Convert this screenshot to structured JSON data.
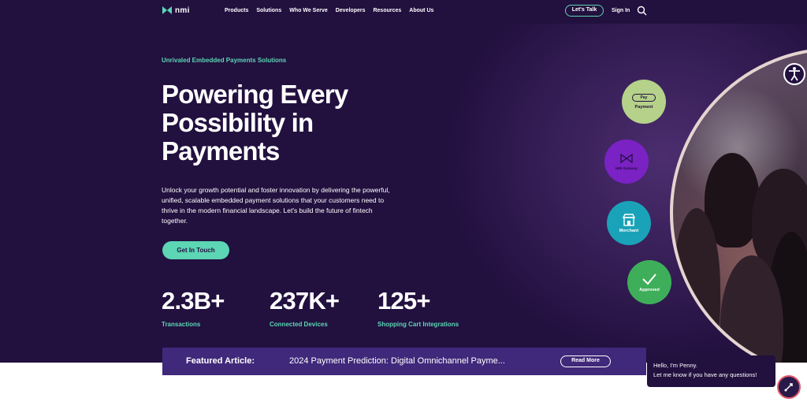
{
  "nav": {
    "logo_text": "nmi",
    "links": [
      "Products",
      "Solutions",
      "Who We Serve",
      "Developers",
      "Resources",
      "About Us"
    ],
    "talk_label": "Let's Talk",
    "signin_label": "Sign In"
  },
  "hero": {
    "eyebrow": "Unrivaled Embedded Payments Solutions",
    "headline": "Powering Every Possibility in Payments",
    "body": "Unlock your growth potential and foster innovation by delivering the powerful, unified, scalable embedded payment solutions that your customers need to thrive in the modern financial landscape. Let's build the future of fintech together.",
    "cta_label": "Get In Touch"
  },
  "stats": [
    {
      "value": "2.3B+",
      "label": "Transactions"
    },
    {
      "value": "237K+",
      "label": "Connected Devices"
    },
    {
      "value": "125+",
      "label": "Shopping Cart Integrations"
    }
  ],
  "bubbles": {
    "payment": {
      "pill": "Pay",
      "label": "Payment"
    },
    "gateway": {
      "label": "NMI Gateway"
    },
    "merchant": {
      "label": "Merchant"
    },
    "approved": {
      "label": "Approved"
    }
  },
  "featured": {
    "label": "Featured Article:",
    "title": "2024 Payment Prediction: Digital Omnichannel Payme...",
    "read_more": "Read More"
  },
  "chat": {
    "line1": "Hello, I'm Penny.",
    "line2": "Let me know if you have any questions!"
  },
  "colors": {
    "hero_bg": "#22103f",
    "accent": "#5cd6b4",
    "featured_bg": "#40287a",
    "bubble_payment": "#b5d18a",
    "bubble_gateway": "#7a22c4",
    "bubble_merchant": "#1aa3b8",
    "bubble_approved": "#3fae5a"
  },
  "icons": [
    "nmi-logo-icon",
    "search-icon",
    "accessibility-icon",
    "gateway-icon",
    "store-icon",
    "checkmark-icon",
    "chat-icon"
  ]
}
